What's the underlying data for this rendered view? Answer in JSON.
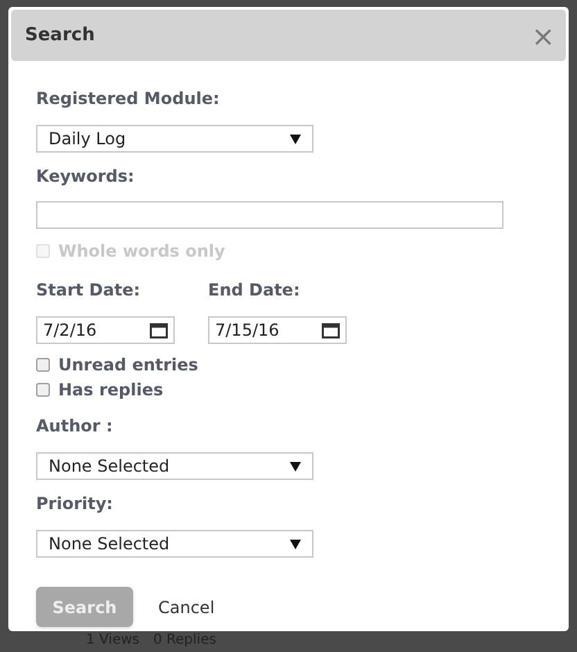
{
  "dialog": {
    "title": "Search",
    "close": "×"
  },
  "module": {
    "label": "Registered Module:",
    "value": "Daily Log"
  },
  "keywords": {
    "label": "Keywords:"
  },
  "whole_words": {
    "label": "Whole words only",
    "checked": false,
    "disabled": true
  },
  "start_date": {
    "label": "Start Date:",
    "value": "7/2/16"
  },
  "end_date": {
    "label": "End Date:",
    "value": "7/15/16"
  },
  "options": [
    {
      "label": "Unread entries",
      "checked": false,
      "disabled": false
    },
    {
      "label": "Has replies",
      "checked": false,
      "disabled": false
    }
  ],
  "author": {
    "label": "Author :",
    "value": "None Selected"
  },
  "priority": {
    "label": "Priority:",
    "value": "None Selected"
  },
  "buttons": {
    "search": {
      "label": "Search",
      "disabled": true
    },
    "cancel": "Cancel"
  },
  "background": {
    "views": "1 Views",
    "replies": "0 Replies"
  }
}
